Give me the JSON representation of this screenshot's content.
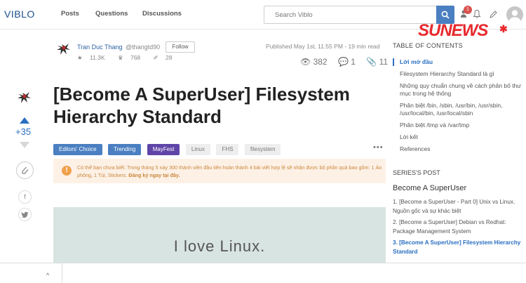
{
  "header": {
    "logo": "VIBLO",
    "nav": [
      {
        "label": "Posts"
      },
      {
        "label": "Questions"
      },
      {
        "label": "Discussions"
      }
    ],
    "search_placeholder": "Search Viblo",
    "notification_count": "1"
  },
  "watermark": "SUNEWS",
  "author": {
    "name": "Tran Duc Thang",
    "handle": "@thangtd90",
    "follow_label": "Follow",
    "reputation": "11.3K",
    "followers": "768",
    "posts": "28"
  },
  "post": {
    "published": "Published May 1st, 11:55 PM - 19 min read",
    "views": "382",
    "comments": "1",
    "clips": "11",
    "score": "+35",
    "title": "[Become A SuperUser] Filesystem Hierarchy Standard",
    "tags": [
      {
        "label": "Editors' Choice",
        "style": "blue"
      },
      {
        "label": "Trending",
        "style": "blue"
      },
      {
        "label": "MayFest",
        "style": "purple"
      },
      {
        "label": "Linux",
        "style": "grey"
      },
      {
        "label": "FHS",
        "style": "grey"
      },
      {
        "label": "filesystem",
        "style": "grey"
      }
    ],
    "notice_text": "Có thể bạn chưa biết: Trong tháng 5 này 300 thành viên đầu tiên hoàn thành 4 bài viết hợp lệ sẽ nhận được bộ phần quà bao gồm: 1 Áo phông, 1 Túi, Stickers. ",
    "notice_link": "Đăng ký ngay tại đây.",
    "hero_text": "I love Linux."
  },
  "toc": {
    "title": "TABLE OF CONTENTS",
    "items": [
      {
        "label": "Lời mở đầu",
        "active": true
      },
      {
        "label": "Filesystem Hierarchy Standard là gì",
        "active": false
      },
      {
        "label": "Những quy chuẩn chung về cách phân bố thư mục trong hệ thống",
        "active": false
      },
      {
        "label": "Phân biệt /bin, /sbin, /usr/bin, /usr/sbin, /usr/local/bin, /usr/local/sbin",
        "active": false
      },
      {
        "label": "Phân biệt /tmp và /var/tmp",
        "active": false
      },
      {
        "label": "Lời kết",
        "active": false
      },
      {
        "label": "References",
        "active": false
      }
    ]
  },
  "series": {
    "heading": "SERIES'S POST",
    "title": "Become A SuperUser",
    "items": [
      {
        "label": "1.   [Become a SuperUser - Part 0] Unix vs Linux. Nguồn gốc và sự khác biệt",
        "active": false
      },
      {
        "label": "2.   [Become a SuperUser] Debian vs Redhat: Package Management System",
        "active": false
      },
      {
        "label": "3.   [Become A SuperUser] Filesystem Hierarchy Standard",
        "active": true
      }
    ]
  },
  "colors": {
    "accent": "#2a6fc1",
    "tag_blue": "#4a7fc1",
    "tag_purple": "#5e45a7",
    "notice_bg": "#fdf1e6",
    "watermark": "#e8292e"
  }
}
